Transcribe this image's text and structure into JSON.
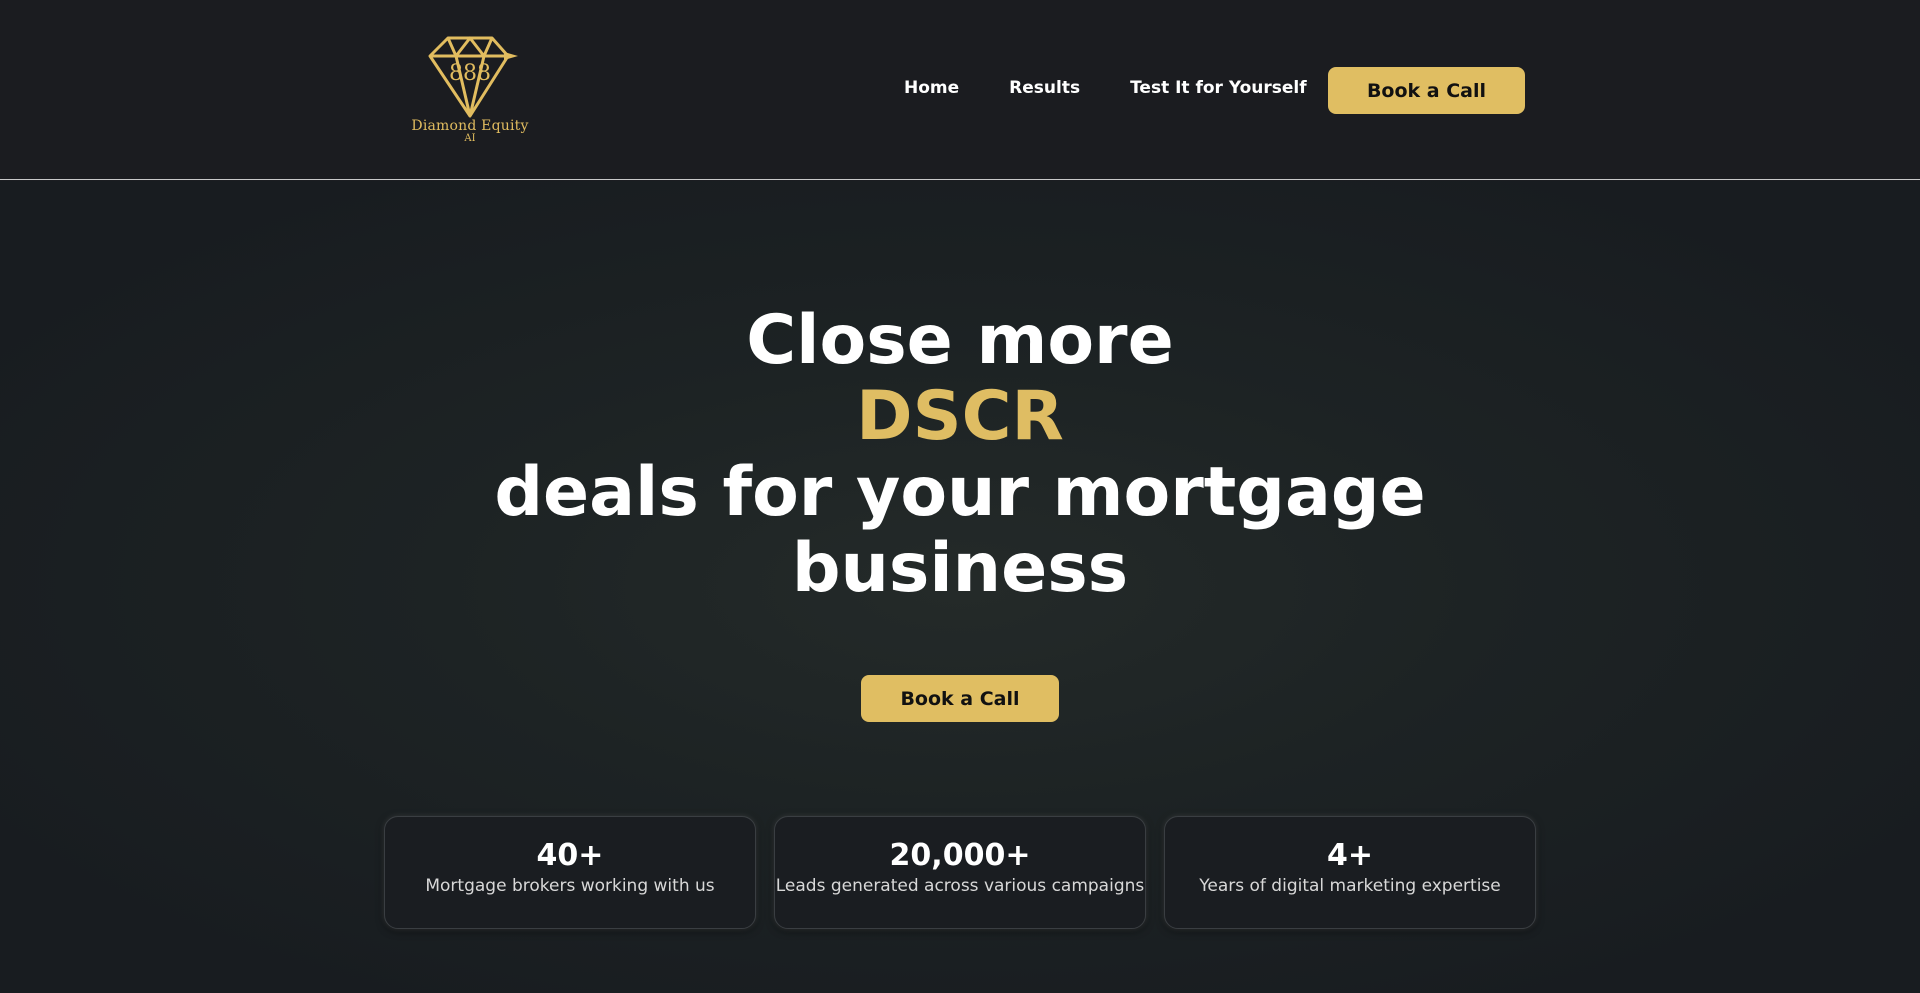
{
  "brand": {
    "logo_mark": "888",
    "name": "Diamond Equity",
    "suffix": "AI",
    "logo_icon": "diamond-icon",
    "accent_color": "#e0be62"
  },
  "nav": {
    "items": [
      {
        "label": "Home"
      },
      {
        "label": "Results"
      },
      {
        "label": "Test It for Yourself"
      }
    ],
    "cta_label": "Book a Call"
  },
  "hero": {
    "headline_line1": "Close more",
    "headline_highlight": "DSCR",
    "headline_line3": "deals for your mortgage",
    "headline_line4": "business",
    "cta_label": "Book a Call"
  },
  "stats": [
    {
      "value": "40+",
      "label": "Mortgage brokers working with us"
    },
    {
      "value": "20,000+",
      "label": "Leads generated across various campaigns"
    },
    {
      "value": "4+",
      "label": "Years of digital marketing expertise"
    }
  ]
}
